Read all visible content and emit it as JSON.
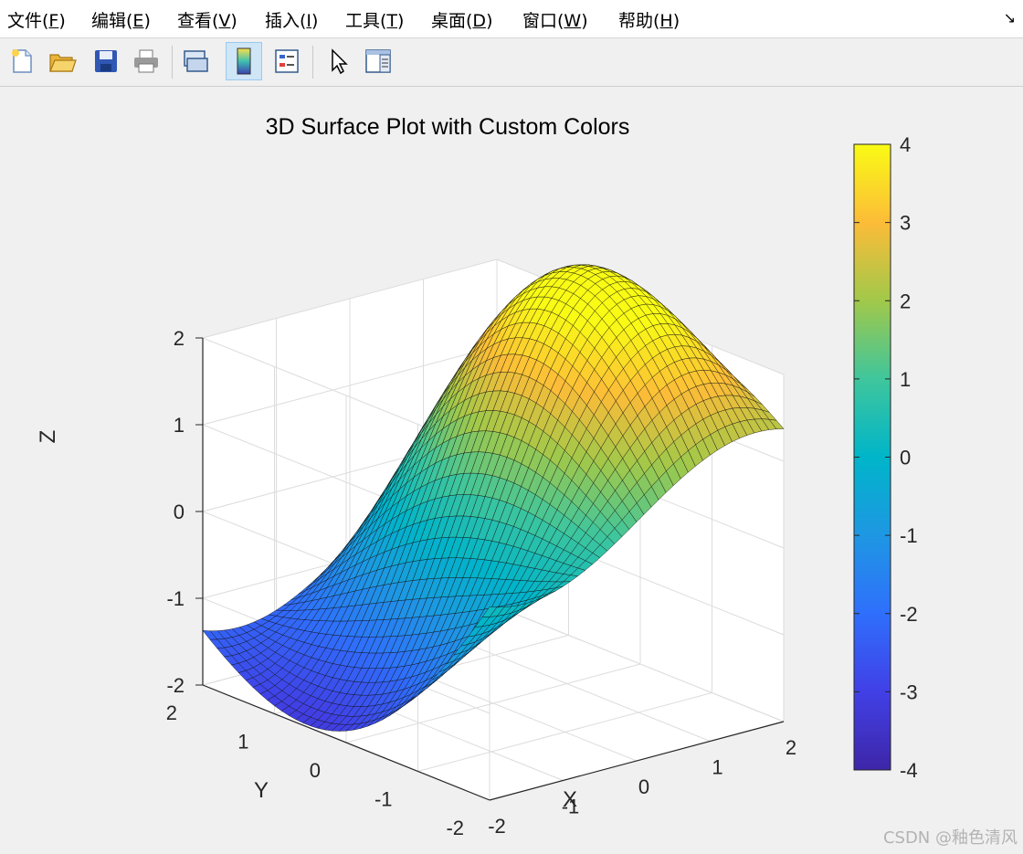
{
  "menu": {
    "items": [
      {
        "label": "文件(",
        "key": "F",
        "tail": ")"
      },
      {
        "label": "编辑(",
        "key": "E",
        "tail": ")"
      },
      {
        "label": "查看(",
        "key": "V",
        "tail": ")"
      },
      {
        "label": "插入(",
        "key": "I",
        "tail": ")"
      },
      {
        "label": "工具(",
        "key": "T",
        "tail": ")"
      },
      {
        "label": "桌面(",
        "key": "D",
        "tail": ")"
      },
      {
        "label": "窗口(",
        "key": "W",
        "tail": ")"
      },
      {
        "label": "帮助(",
        "key": "H",
        "tail": ")"
      }
    ],
    "corner_icon": "↘"
  },
  "toolbar": {
    "buttons": [
      {
        "icon": "new-figure-icon"
      },
      {
        "icon": "open-file-icon"
      },
      {
        "icon": "save-icon"
      },
      {
        "icon": "print-icon"
      },
      {
        "icon": "link-plot-icon"
      },
      {
        "icon": "colorbar-icon",
        "active": true
      },
      {
        "icon": "legend-icon"
      },
      {
        "icon": "edit-plot-pointer-icon"
      },
      {
        "icon": "property-inspector-icon"
      }
    ]
  },
  "chart_data": {
    "type": "surface",
    "title": "3D Surface Plot with Custom Colors",
    "xlabel": "X",
    "ylabel": "Y",
    "zlabel": "Z",
    "xlim": [
      -2,
      2
    ],
    "ylim": [
      -2,
      2
    ],
    "zlim": [
      -2,
      2
    ],
    "xticks": [
      "-2",
      "-1",
      "0",
      "1",
      "2"
    ],
    "yticks": [
      "-2",
      "-1",
      "0",
      "1",
      "2"
    ],
    "zticks": [
      "-2",
      "-1",
      "0",
      "1",
      "2"
    ],
    "function": "sin(x)*cos(y)*... approximated saddle-like ridge",
    "colormap": "parula",
    "colorbar": {
      "limits": [
        -4,
        4
      ],
      "ticks": [
        "4",
        "3",
        "2",
        "1",
        "0",
        "-1",
        "-2",
        "-3",
        "-4"
      ]
    },
    "grid": true
  },
  "watermark": "CSDN @釉色清风"
}
